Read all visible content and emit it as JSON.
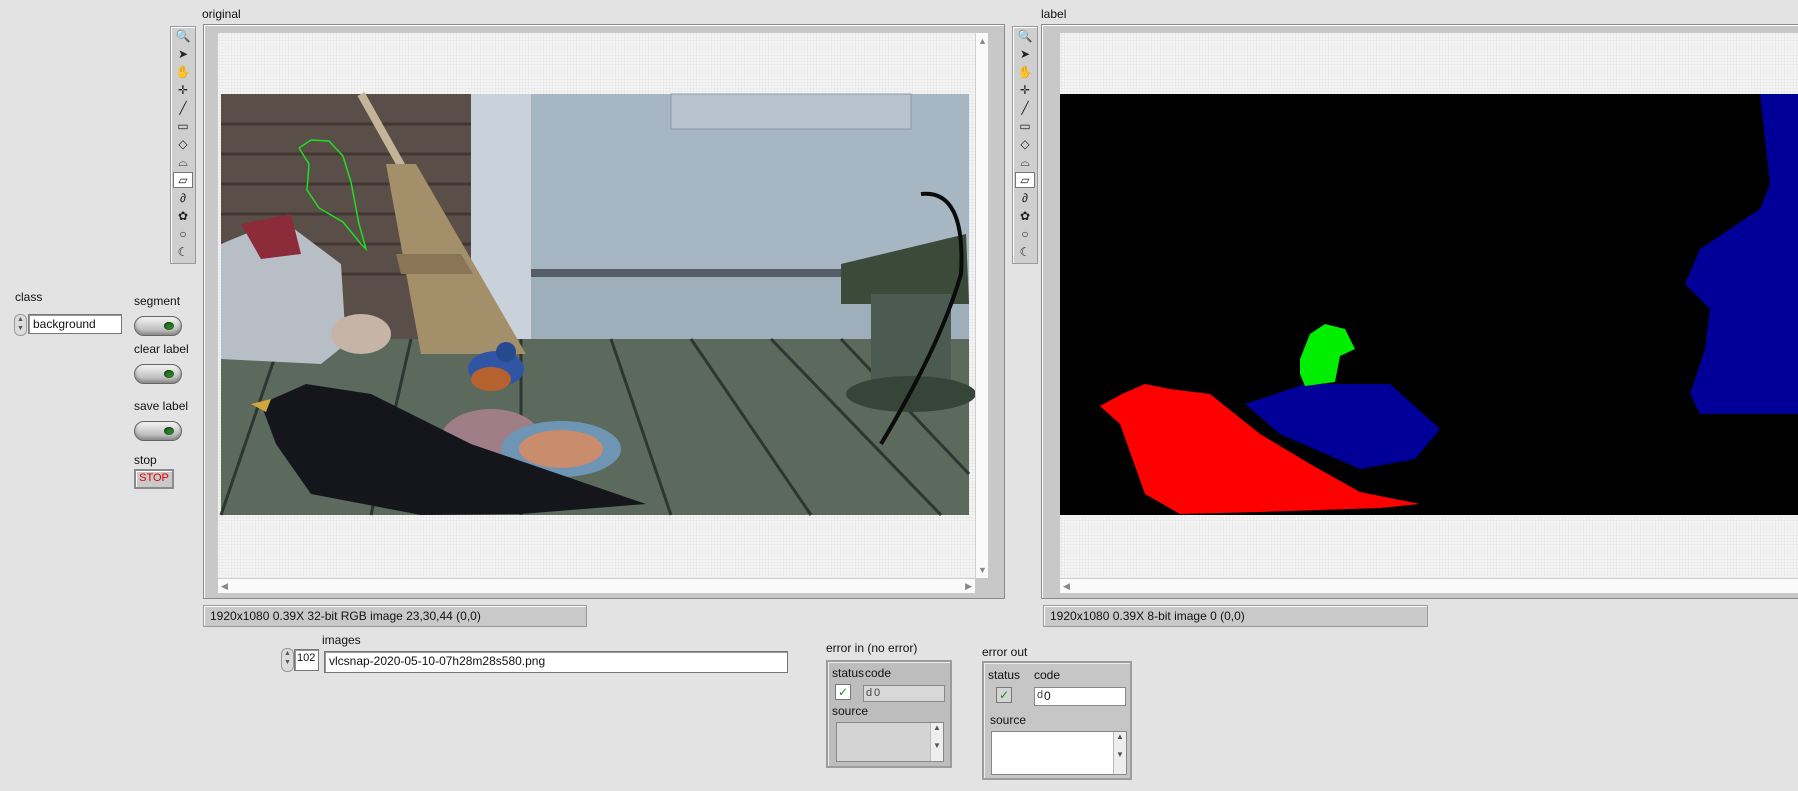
{
  "controls": {
    "class_label": "class",
    "class_value": "background",
    "segment_label": "segment",
    "clear_label_label": "clear label",
    "save_label_label": "save label",
    "stop_label": "stop",
    "stop_button": "STOP"
  },
  "original": {
    "label": "original",
    "info": "1920x1080 0.39X 32-bit RGB image 23,30,44    (0,0)"
  },
  "label_display": {
    "label": "label",
    "info": "1920x1080 0.39X 8-bit image 0    (0,0)"
  },
  "palette_tools": [
    "zoom-icon",
    "pointer-icon",
    "pan-icon",
    "crosshair-icon",
    "line-icon",
    "rectangle-icon",
    "rotated-rectangle-icon",
    "annulus-icon",
    "polygon-icon",
    "freehand-icon",
    "broken-line-icon",
    "oval-icon",
    "free-region-icon"
  ],
  "images": {
    "label": "images",
    "index": "102",
    "path": "vlcsnap-2020-05-10-07h28m28s580.png"
  },
  "error_in": {
    "label": "error in (no error)",
    "status_label": "status",
    "code_label": "code",
    "code_value": "0",
    "code_prefix": "d",
    "source_label": "source",
    "status_mark": "✓"
  },
  "error_out": {
    "label": "error out",
    "status_label": "status",
    "code_label": "code",
    "code_value": "0",
    "code_prefix": "d",
    "source_label": "source",
    "status_mark": "✓"
  },
  "colors": {
    "segment_red": "#ff0000",
    "segment_blue": "#000099",
    "segment_green": "#00ee00",
    "outline_green": "#22dd22",
    "stop_text": "#dd0000"
  }
}
